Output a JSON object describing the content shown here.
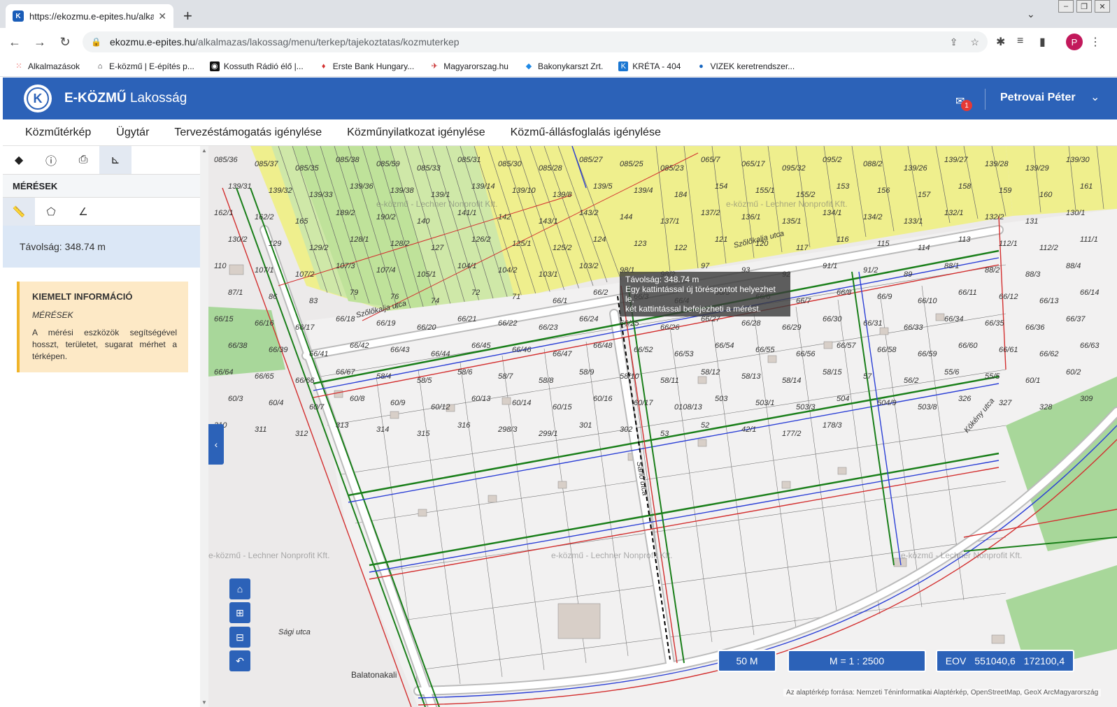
{
  "browser": {
    "tab_title": "https://ekozmu.e-epites.hu/alkalma",
    "url_domain": "ekozmu.e-epites.hu",
    "url_path": "/alkalmazas/lakossag/menu/terkep/tajekoztatas/kozmuterkep",
    "avatar_letter": "P",
    "bookmarks": [
      {
        "label": "Alkalmazások",
        "icon": "apps-grid-icon"
      },
      {
        "label": "E-közmű | E-építés p...",
        "icon": "home-icon"
      },
      {
        "label": "Kossuth Rádió élő |...",
        "icon": "radio-icon"
      },
      {
        "label": "Erste Bank Hungary...",
        "icon": "erste-icon"
      },
      {
        "label": "Magyarorszag.hu",
        "icon": "magyarorszag-icon"
      },
      {
        "label": "Bakonykarszt Zrt.",
        "icon": "bakonykarszt-icon"
      },
      {
        "label": "KRÉTA - 404",
        "icon": "kreta-icon"
      },
      {
        "label": "VIZEK keretrendszer...",
        "icon": "globe-icon"
      }
    ]
  },
  "app": {
    "brand_bold": "E-KÖZMŰ",
    "brand_light": "Lakosság",
    "logo_letter": "K",
    "notification_count": "1",
    "user_name": "Petrovai Péter",
    "nav": [
      "Közműtérkép",
      "Ügytár",
      "Tervezéstámogatás igénylése",
      "Közműnyilatkozat igénylése",
      "Közmű-állásfoglalás igénylése"
    ]
  },
  "sidebar": {
    "section_title": "MÉRÉSEK",
    "result_text": "Távolság: 348.74 m",
    "info": {
      "title": "KIEMELT INFORMÁCIÓ",
      "subtitle": "MÉRÉSEK",
      "text": "A mérési eszközök segítségével hosszt, területet, sugarat mérhet a térképen."
    }
  },
  "map": {
    "tooltip_line1": "Távolság: 348.74 m",
    "tooltip_line2": "Egy kattintással új töréspontot helyezhet le,",
    "tooltip_line3": "két kattintással befejezheti a mérést.",
    "scale_bar": "50 M",
    "scale_ratio": "M = 1 : 2500",
    "eov_label": "EOV",
    "eov_x": "551040,6",
    "eov_y": "172100,4",
    "attribution": "Az alaptérkép forrása: Nemzeti Téninformatikai Alaptérkép, OpenStreetMap, GeoX ArcMagyarország",
    "watermark": "e-közmű - Lechner Nonprofit Kft.",
    "place_name": "Balatonakali",
    "streets": [
      "Szőlőkalja utca",
      "Szőlőkalja utca",
      "Sarló utca",
      "Kökény utca",
      "Sági utca"
    ],
    "parcel_labels": [
      "085/36",
      "085/37",
      "085/35",
      "085/38",
      "085/59",
      "085/33",
      "085/31",
      "085/30",
      "085/28",
      "085/27",
      "085/25",
      "085/23",
      "065/7",
      "065/17",
      "095/32",
      "095/2",
      "088/2",
      "139/26",
      "139/27",
      "139/28",
      "139/29",
      "139/30",
      "139/31",
      "139/32",
      "139/33",
      "139/36",
      "139/38",
      "139/1",
      "139/14",
      "139/10",
      "139/8",
      "139/5",
      "139/4",
      "184",
      "154",
      "155/1",
      "155/2",
      "153",
      "156",
      "157",
      "158",
      "159",
      "160",
      "161",
      "162/1",
      "162/2",
      "165",
      "189/2",
      "190/2",
      "140",
      "141/1",
      "142",
      "143/1",
      "143/2",
      "144",
      "137/1",
      "137/2",
      "136/1",
      "135/1",
      "134/1",
      "134/2",
      "133/1",
      "132/1",
      "132/2",
      "131",
      "130/1",
      "130/2",
      "129",
      "129/2",
      "128/1",
      "128/2",
      "127",
      "126/2",
      "125/1",
      "125/2",
      "124",
      "123",
      "122",
      "121",
      "120",
      "117",
      "116",
      "115",
      "114",
      "113",
      "112/1",
      "112/2",
      "111/1",
      "110",
      "107/1",
      "107/2",
      "107/3",
      "107/4",
      "105/1",
      "104/1",
      "104/2",
      "103/1",
      "103/2",
      "98/1",
      "98/2",
      "97",
      "93",
      "92",
      "91/1",
      "91/2",
      "89",
      "88/1",
      "88/2",
      "88/3",
      "88/4",
      "87/1",
      "86",
      "83",
      "79",
      "76",
      "74",
      "72",
      "71",
      "66/1",
      "66/2",
      "66/3",
      "66/4",
      "66/5",
      "66/6",
      "66/7",
      "66/8",
      "66/9",
      "66/10",
      "66/11",
      "66/12",
      "66/13",
      "66/14",
      "66/15",
      "66/16",
      "66/17",
      "66/18",
      "66/19",
      "66/20",
      "66/21",
      "66/22",
      "66/23",
      "66/24",
      "66/25",
      "66/26",
      "66/27",
      "66/28",
      "66/29",
      "66/30",
      "66/31",
      "66/33",
      "66/34",
      "66/35",
      "66/36",
      "66/37",
      "66/38",
      "66/39",
      "66/41",
      "66/42",
      "66/43",
      "66/44",
      "66/45",
      "66/46",
      "66/47",
      "66/48",
      "66/52",
      "66/53",
      "66/54",
      "66/55",
      "66/56",
      "66/57",
      "66/58",
      "66/59",
      "66/60",
      "66/61",
      "66/62",
      "66/63",
      "66/64",
      "66/65",
      "66/66",
      "66/67",
      "58/4",
      "58/5",
      "58/6",
      "58/7",
      "58/8",
      "58/9",
      "58/10",
      "58/11",
      "58/12",
      "58/13",
      "58/14",
      "58/15",
      "57",
      "56/2",
      "55/6",
      "55/5",
      "60/1",
      "60/2",
      "60/3",
      "60/4",
      "60/7",
      "60/8",
      "60/9",
      "60/12",
      "60/13",
      "60/14",
      "60/15",
      "60/16",
      "60/17",
      "0108/13",
      "503",
      "503/1",
      "503/3",
      "504",
      "504/9",
      "503/8",
      "326",
      "327",
      "328",
      "309",
      "310",
      "311",
      "312",
      "313",
      "314",
      "315",
      "316",
      "298/3",
      "299/1",
      "301",
      "302",
      "53",
      "52",
      "42/1",
      "177/2",
      "178/3"
    ]
  }
}
